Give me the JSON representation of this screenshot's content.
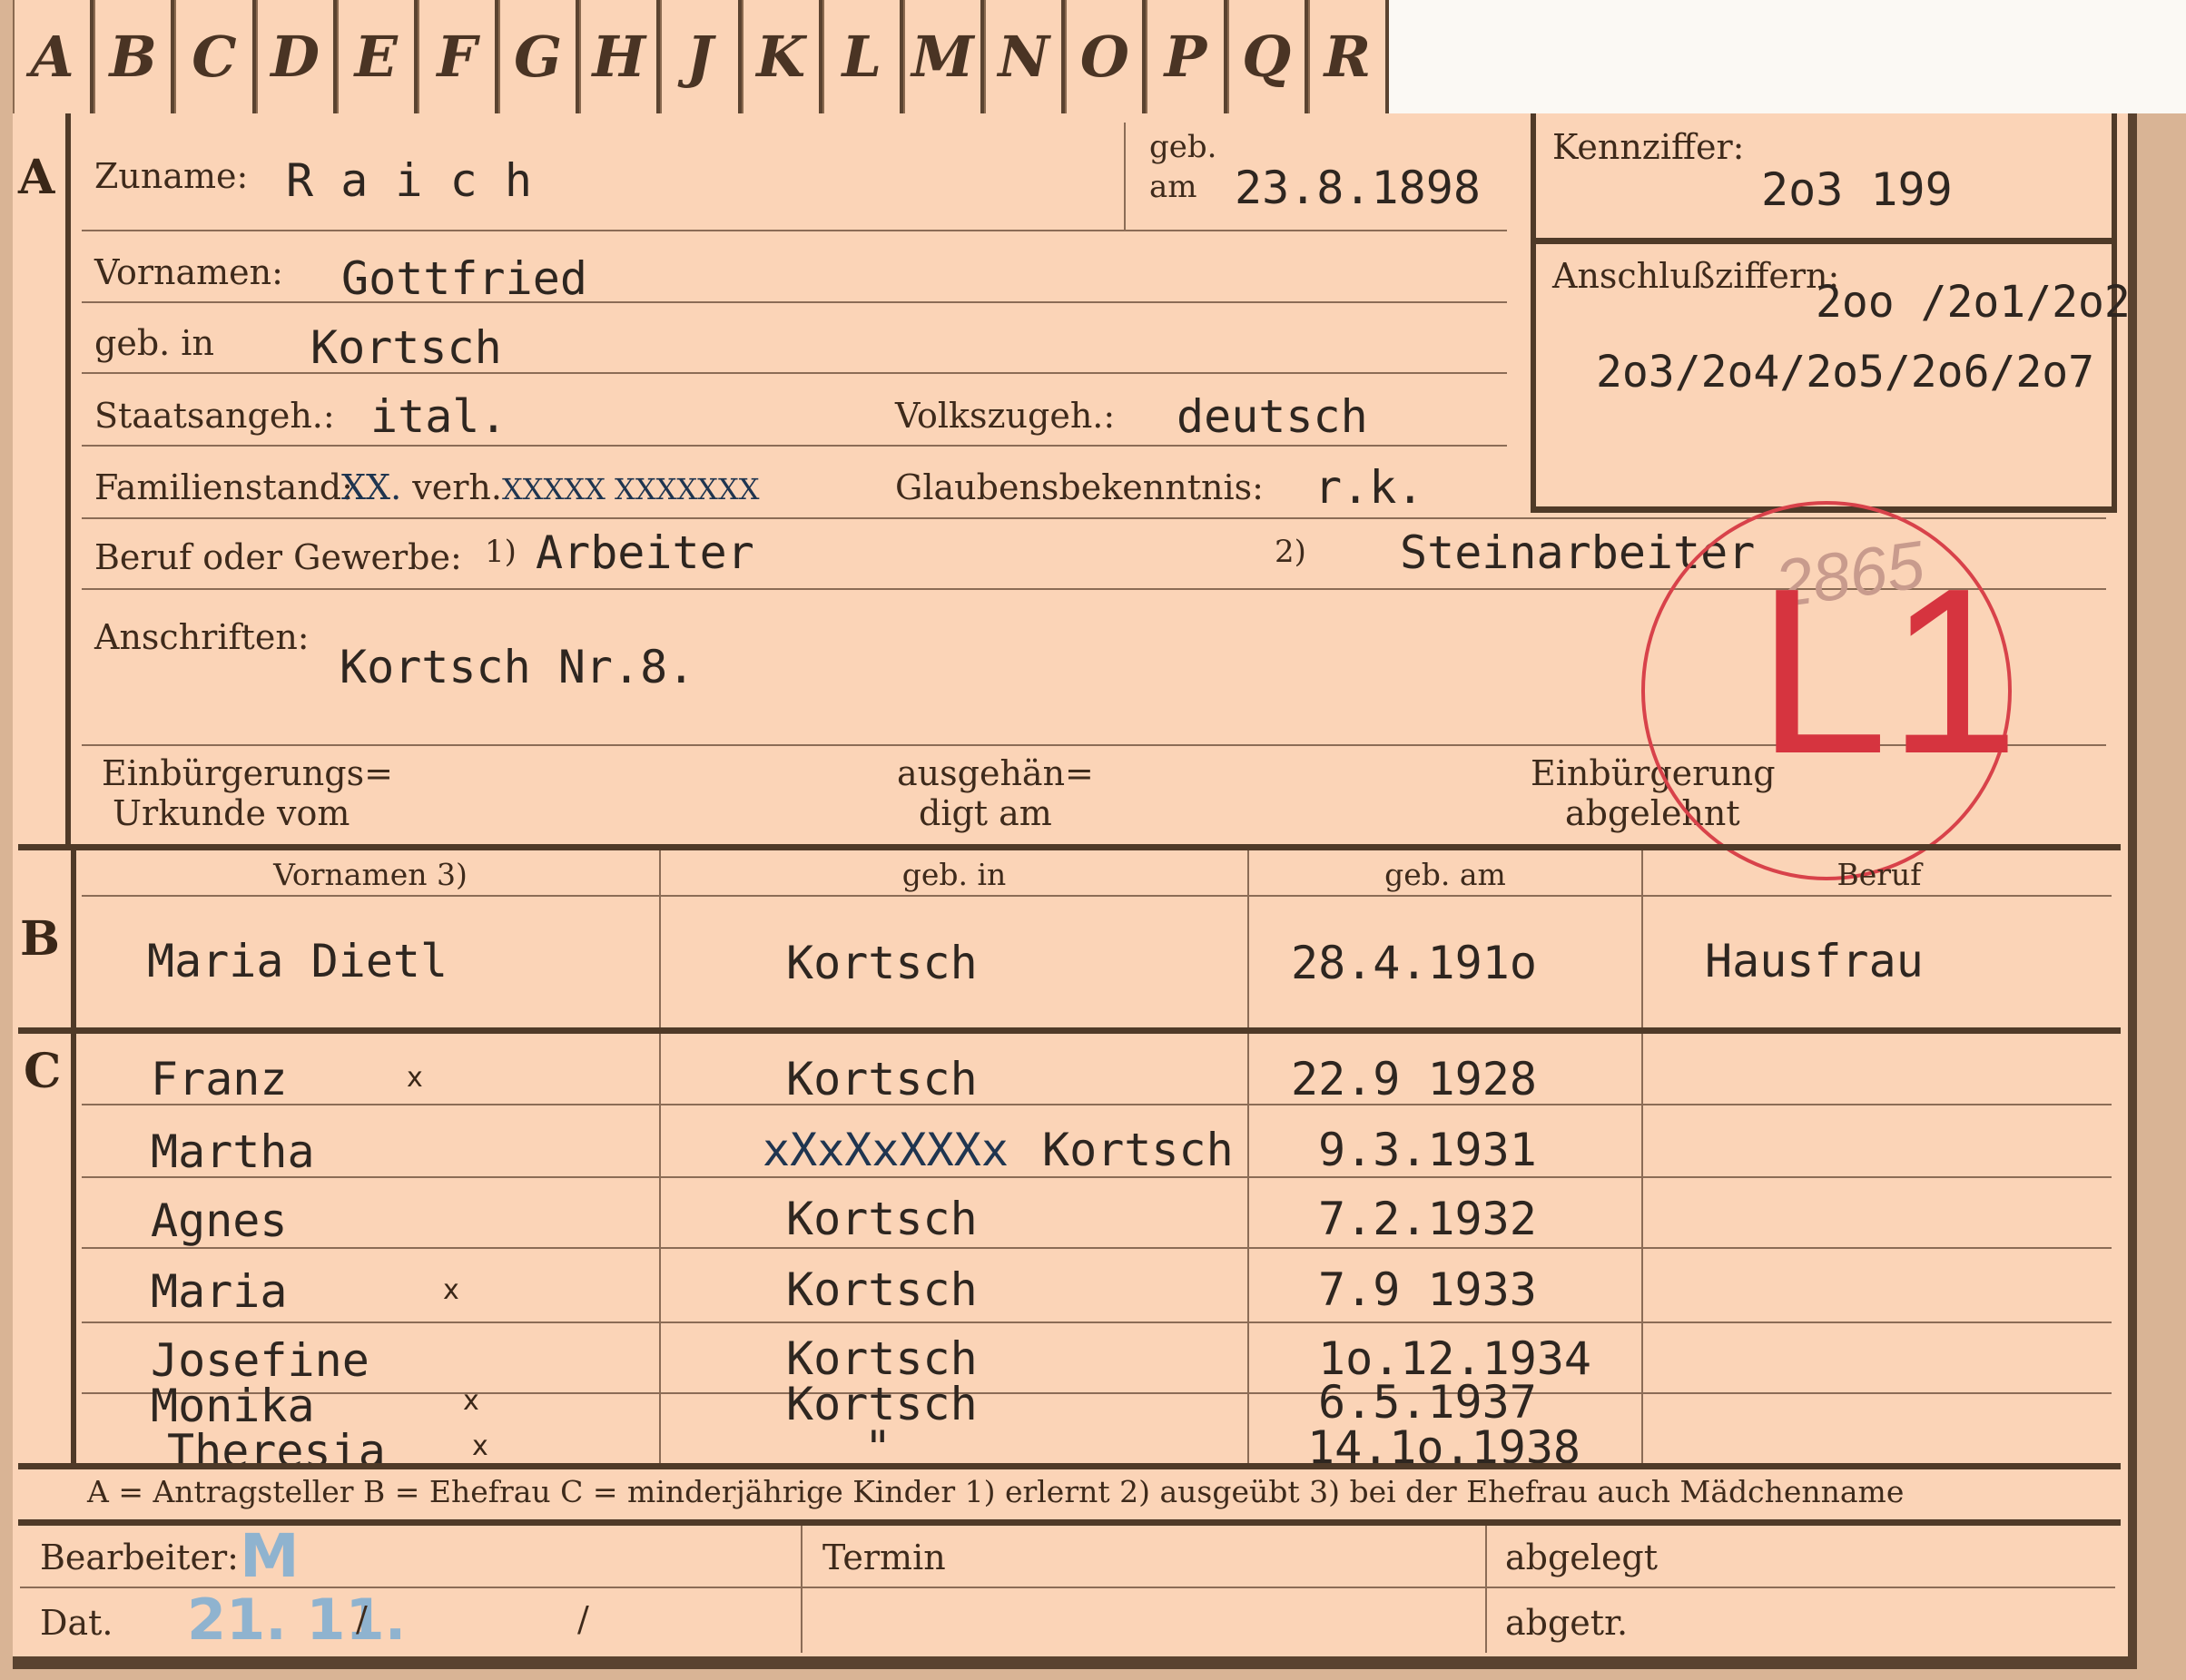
{
  "tabs": [
    "A",
    "B",
    "C",
    "D",
    "E",
    "F",
    "G",
    "H",
    "J",
    "K",
    "L",
    "M",
    "N",
    "O",
    "P",
    "Q",
    "R"
  ],
  "sections": {
    "a": "A",
    "b": "B",
    "c": "C"
  },
  "applicant": {
    "surname_label": "Zuname:",
    "surname": "R a i c h",
    "born_on_label_top": "geb.",
    "born_on_label_bottom": "am",
    "born_on": "23.8.1898",
    "id_label": "Kennziffer:",
    "id": "2o3 199",
    "linked_label": "Anschlußziffern:",
    "linked_line1": "2oo /2o1/2o2",
    "linked_line2": "2o3/2o4/2o5/2o6/2o7",
    "first_names_label": "Vornamen:",
    "first_names": "Gottfried",
    "birthplace_label": "geb. in",
    "birthplace": "Kortsch",
    "citizenship_label": "Staatsangeh.:",
    "citizenship": "ital.",
    "ethnicity_label": "Volkszugeh.:",
    "ethnicity": "deutsch",
    "marital_label": "Familienstand:",
    "marital_strike1": "XX.",
    "marital_value": " verh.",
    "marital_strike2": "XXXXX XXXXXXX",
    "religion_label": "Glaubensbekenntnis:",
    "religion": "r.k.",
    "occupation_label": "Beruf oder Gewerbe:",
    "occ1_marker": "1)",
    "occupation1": "Arbeiter",
    "occ2_marker": "2)",
    "occupation2": "Steinarbeiter",
    "address_label": "Anschriften:",
    "address": "Kortsch Nr.8.",
    "natur_cert_label1": "Einbürgerungs=",
    "natur_cert_label2": "Urkunde vom",
    "handed_label1": "ausgehän=",
    "handed_label2": "digt am",
    "natur_denied_label1": "Einbürgerung",
    "natur_denied_label2": "abgelehnt"
  },
  "stamp": {
    "code": "L1",
    "number": "2865"
  },
  "spouse": {
    "col_headers": [
      "Vornamen 3)",
      "geb. in",
      "geb. am",
      "Beruf"
    ],
    "name": "Maria Dietl",
    "birthplace": "Kortsch",
    "born_on": "28.4.191o",
    "occupation": "Hausfrau"
  },
  "children": [
    {
      "name": "Franz",
      "mark": "x",
      "birthplace": "Kortsch",
      "born_on": "22.9 1928"
    },
    {
      "name": "Martha",
      "mark": "",
      "birthplace_strike": "xXxXxXXXx",
      "birthplace": "Kortsch",
      "born_on": "9.3.1931"
    },
    {
      "name": "Agnes",
      "mark": "",
      "birthplace": "Kortsch",
      "born_on": "7.2.1932"
    },
    {
      "name": "Maria",
      "mark": "x",
      "birthplace": "Kortsch",
      "born_on": "7.9 1933"
    },
    {
      "name": "Josefine",
      "mark": "",
      "birthplace": "Kortsch",
      "born_on": "1o.12.1934"
    },
    {
      "name": "Monika",
      "mark": "x",
      "birthplace": "Kortsch",
      "born_on": "6.5.1937"
    },
    {
      "name": "Theresia",
      "mark": "x",
      "birthplace": "\"",
      "born_on": "14.1o.1938"
    }
  ],
  "legend": "A = Antragsteller    B = Ehefrau    C = minderjährige Kinder   1) erlernt    2) ausgeübt    3) bei der Ehefrau auch Mädchenname",
  "footer": {
    "clerk_label": "Bearbeiter:",
    "clerk_value": "M",
    "date_label": "Dat.",
    "date_value": "21. 11.",
    "slash1": "/",
    "slash2": "/",
    "deadline_label": "Termin",
    "filed_label": "abgelegt",
    "retrieved_label": "abgetr."
  }
}
